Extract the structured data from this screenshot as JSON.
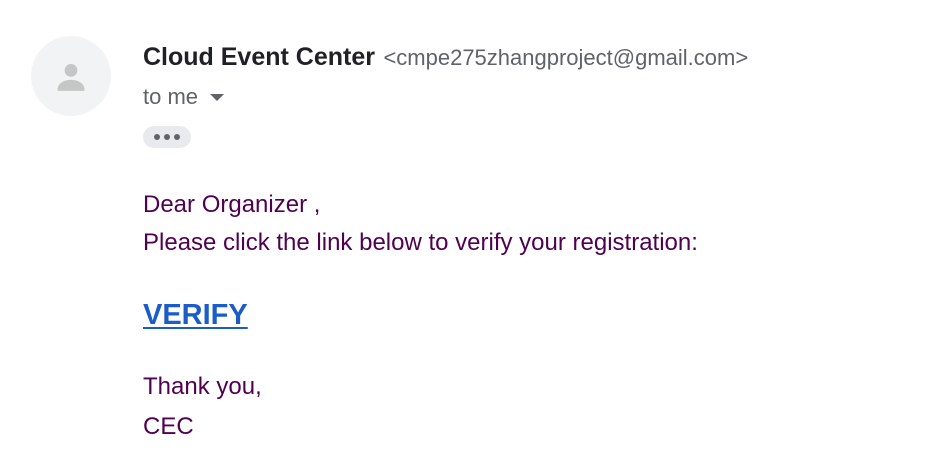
{
  "sender": {
    "name": "Cloud Event Center",
    "email": "<cmpe275zhangproject@gmail.com>",
    "avatar_icon": "person-icon"
  },
  "recipient": {
    "label": "to me",
    "dropdown_icon": "caret-down-icon"
  },
  "show_trimmed_icon": "more-horiz-icon",
  "message": {
    "greeting": "Dear Organizer ,",
    "instruction": "Please click the link below to verify your registration:",
    "link_label": "VERIFY",
    "closing": "Thank you,",
    "signature": "CEC"
  },
  "colors": {
    "body_text": "#500050",
    "link": "#1a5cc8",
    "sender_name": "#202124",
    "secondary": "#5f6368",
    "avatar_bg": "#f1f3f4"
  }
}
